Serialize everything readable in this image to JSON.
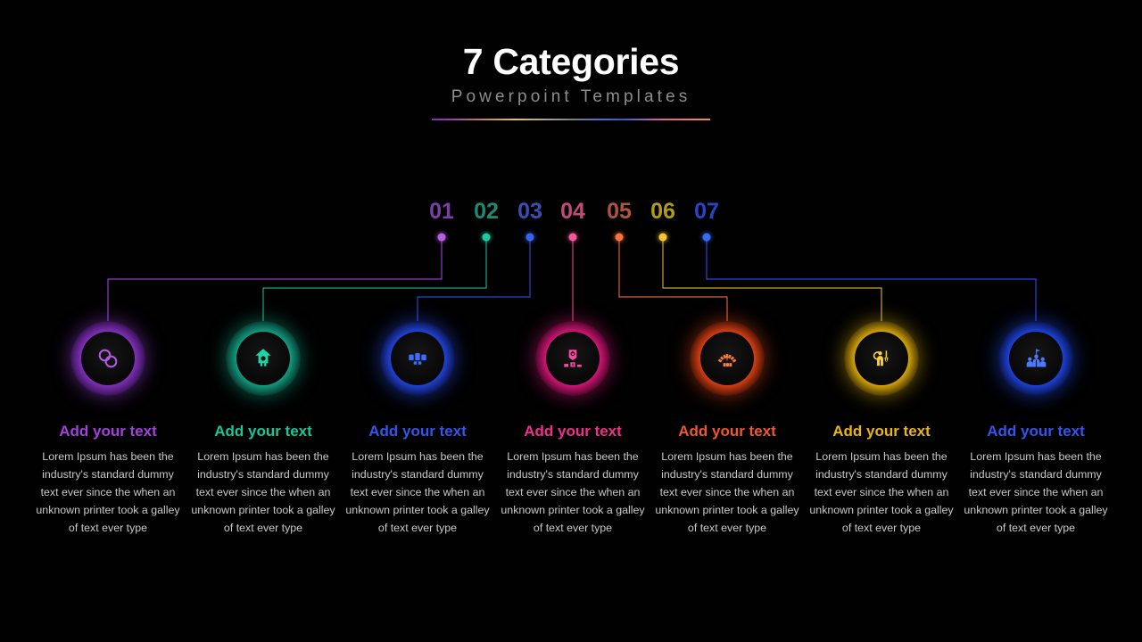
{
  "header": {
    "title": "7 Categories",
    "subtitle": "Powerpoint Templates"
  },
  "palette": {
    "purple": "#9b3fd4",
    "green": "#17b894",
    "blue": "#2346e8",
    "pink": "#e91e7b",
    "orange": "#f04e23",
    "yellow": "#eab308",
    "blue2": "#1f48e0"
  },
  "number_colors": {
    "n01": "#7b3fa8",
    "n02": "#1e8a72",
    "n03": "#3a4fb0",
    "n04": "#c04a7a",
    "n05": "#b0553a",
    "n06": "#b09a20",
    "n07": "#2a44c8"
  },
  "dot_colors": {
    "d01": "#b65fe0",
    "d02": "#22c79e",
    "d03": "#3c63ee",
    "d04": "#f05a9b",
    "d05": "#f4733f",
    "d06": "#f5c531",
    "d07": "#3a6bf0"
  },
  "items": [
    {
      "number": "01",
      "title": "Add your text",
      "body": "Lorem Ipsum has been the industry's standard dummy text ever since the when an unknown printer took a galley of text ever type",
      "icon": "link-rings-icon",
      "color": "#9b3fd4",
      "title_color": "#a43fe0"
    },
    {
      "number": "02",
      "title": "Add your text",
      "body": "Lorem Ipsum has been the industry's standard dummy text ever since the when an unknown printer took a galley of text ever type",
      "icon": "home-shield-icon",
      "color": "#17b894",
      "title_color": "#16c79a"
    },
    {
      "number": "03",
      "title": "Add your text",
      "body": "Lorem Ipsum has been the industry's standard dummy text ever since the when an unknown printer took a galley of text ever type",
      "icon": "briefcase-icon",
      "color": "#2346e8",
      "title_color": "#3355ee"
    },
    {
      "number": "04",
      "title": "Add your text",
      "body": "Lorem Ipsum has been the industry's standard dummy text ever since the when an unknown printer took a galley of text ever type",
      "icon": "award-podium-icon",
      "color": "#e91e7b",
      "title_color": "#ef2f8c"
    },
    {
      "number": "05",
      "title": "Add your text",
      "body": "Lorem Ipsum has been the industry's standard dummy text ever since the when an unknown printer took a galley of text ever type",
      "icon": "speedometer-icon",
      "color": "#f04e23",
      "title_color": "#f0572e"
    },
    {
      "number": "06",
      "title": "Add your text",
      "body": "Lorem Ipsum has been the industry's standard dummy text ever since the when an unknown printer took a galley of text ever type",
      "icon": "person-target-icon",
      "color": "#eab308",
      "title_color": "#e8b417"
    },
    {
      "number": "07",
      "title": "Add your text",
      "body": "Lorem Ipsum has been the industry's standard dummy text ever since the when an unknown printer took a galley of text ever type",
      "icon": "team-growth-icon",
      "color": "#1f48e0",
      "title_color": "#3355ee"
    }
  ]
}
